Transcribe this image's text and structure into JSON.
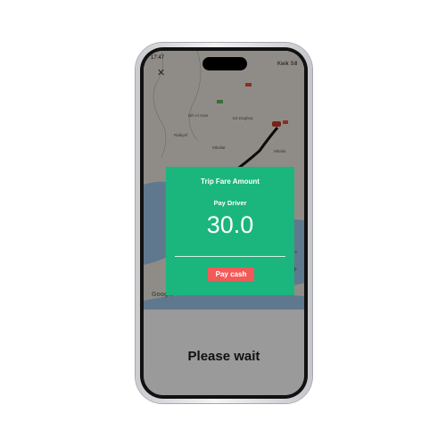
{
  "status_bar": {
    "time": "17:47",
    "carrier": "Kwik Sill",
    "right_text": "Kwik Sill"
  },
  "map": {
    "labels": [
      "Dih Al Aran",
      "Ed Doghna",
      "Rabiyef",
      "Mhalia",
      "Mhallat",
      "Lahore"
    ],
    "google": "Google"
  },
  "dialog": {
    "title": "Trip Fare Amount",
    "subtitle": "Pay Driver",
    "amount": "30.0",
    "button": "Pay cash"
  },
  "footer": {
    "message": "Please wait"
  },
  "colors": {
    "accent": "#1bb57e",
    "button": "#f25a58"
  }
}
